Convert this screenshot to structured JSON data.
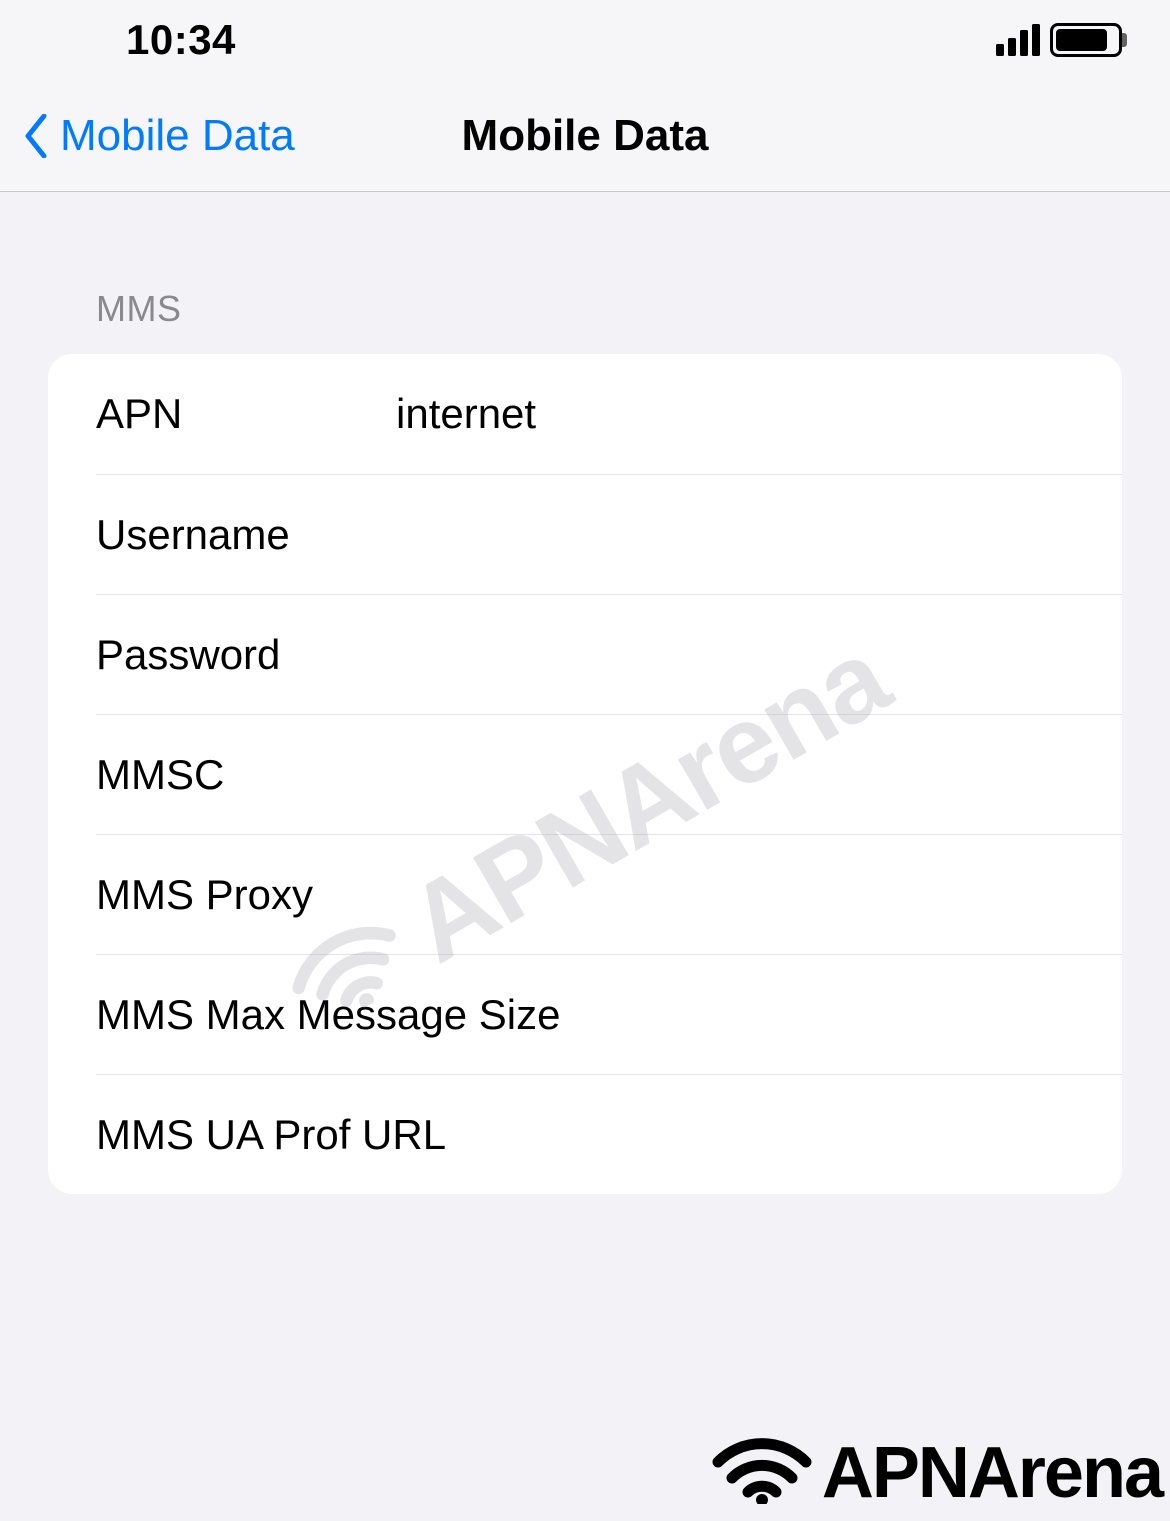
{
  "status_bar": {
    "time": "10:34"
  },
  "nav": {
    "back_label": "Mobile Data",
    "title": "Mobile Data"
  },
  "section": {
    "header": "MMS",
    "rows": [
      {
        "label": "APN",
        "value": "internet"
      },
      {
        "label": "Username",
        "value": ""
      },
      {
        "label": "Password",
        "value": ""
      },
      {
        "label": "MMSC",
        "value": ""
      },
      {
        "label": "MMS Proxy",
        "value": ""
      },
      {
        "label": "MMS Max Message Size",
        "value": ""
      },
      {
        "label": "MMS UA Prof URL",
        "value": ""
      }
    ]
  },
  "watermark": {
    "text": "APNArena"
  }
}
